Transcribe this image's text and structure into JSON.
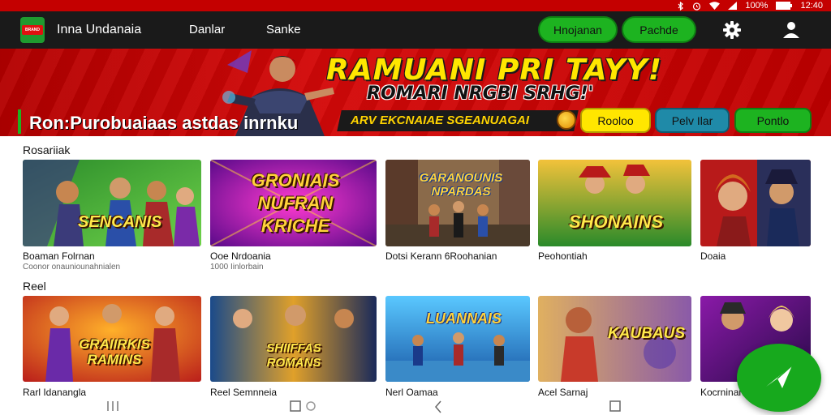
{
  "status_bar": {
    "battery": "100%",
    "time": "12:40"
  },
  "app_bar": {
    "title": "Inna Undanaia",
    "nav": [
      "Danlar",
      "Sanke"
    ],
    "buttons": [
      "Hnojanan",
      "Pachde"
    ],
    "icons": [
      "gear-icon",
      "user-icon"
    ]
  },
  "banner": {
    "headline": "RAMUANI PRI TAYY!",
    "subline": "ROMARI NRGBI SRHG!'",
    "promo": "ARV EKCNAIAE SGEANUAGAI",
    "tagline": "Ron:Purobuaiaas astdas inrnku",
    "buttons": [
      {
        "label": "Rooloo",
        "color": "#ffe600"
      },
      {
        "label": "Pelv Ilar",
        "color": "#1f8aa8"
      },
      {
        "label": "Pontlo",
        "color": "#1db320"
      }
    ]
  },
  "sections": [
    {
      "title": "Rosariiak",
      "cards": [
        {
          "art_title": "SENCANIS",
          "caption": "Boaman Folrnan",
          "sub": "Coonor onauniounahnialen"
        },
        {
          "art_title": "GRONIAIS NUFRAN KRICHE",
          "caption": "Ooe Nrdoania",
          "sub": "1000 Iinlorbain"
        },
        {
          "art_title": "GARANOUNIS NPARDAS",
          "caption": "Dotsi Kerann 6Roohanian",
          "sub": ""
        },
        {
          "art_title": "SHONAINS",
          "caption": "Peohontiah",
          "sub": ""
        },
        {
          "art_title": "",
          "caption": "Doaia",
          "sub": ""
        }
      ]
    },
    {
      "title": "Reel",
      "cards": [
        {
          "art_title": "GRAIIRKIS RAMINS",
          "caption": "Rarl Idanangla",
          "sub": ""
        },
        {
          "art_title": "SHIIFFAS ROMANS",
          "caption": "Reel Semnneia",
          "sub": ""
        },
        {
          "art_title": "LUANNAIS",
          "caption": "Nerl Oamaa",
          "sub": ""
        },
        {
          "art_title": "KAUBAUS",
          "caption": "Acel Sarnaj",
          "sub": ""
        },
        {
          "art_title": "",
          "caption": "Kocrninan",
          "sub": ""
        }
      ]
    }
  ],
  "colors": {
    "brand_red": "#c40000",
    "brand_green": "#1db320",
    "appbar": "#1a1a1a"
  }
}
